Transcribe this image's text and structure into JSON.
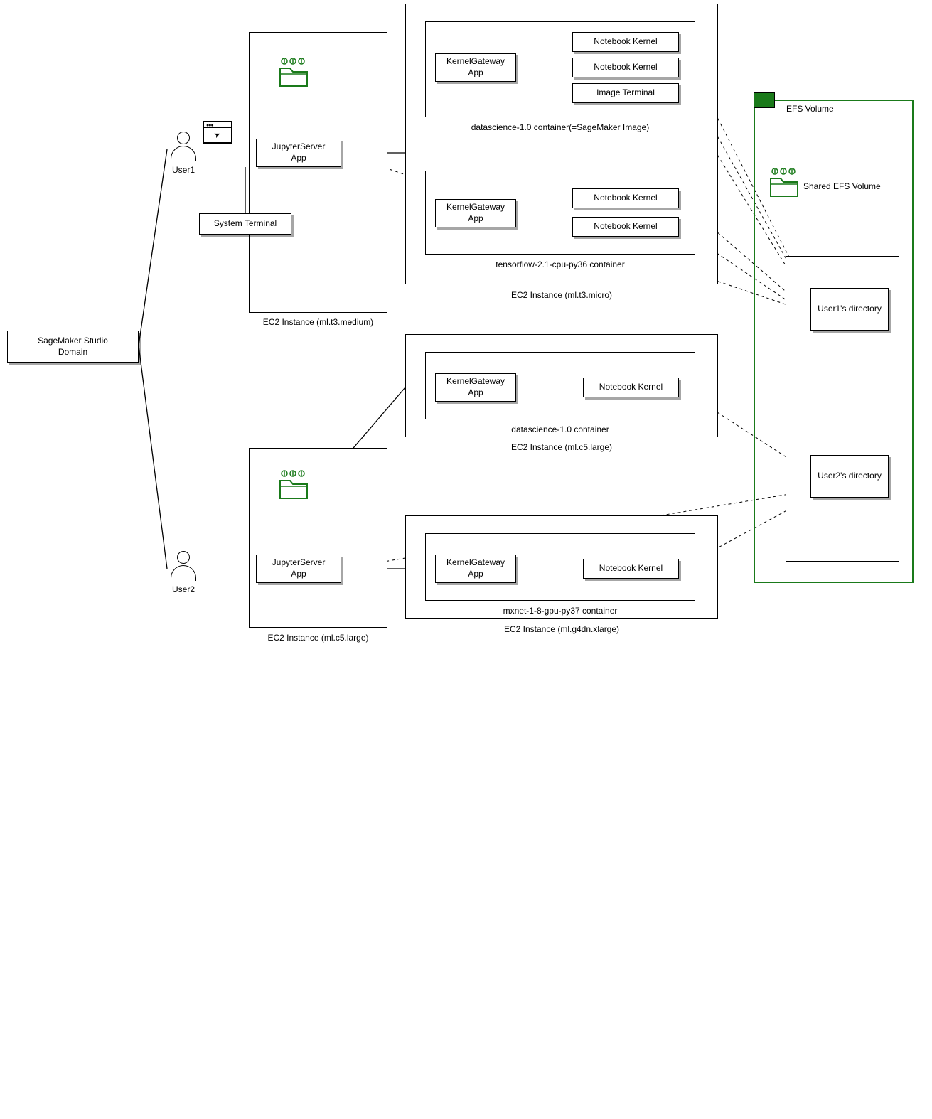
{
  "domain_box": "SageMaker Studio\nDomain",
  "user1_label": "User1",
  "user2_label": "User2",
  "instance1_label": "EC2 Instance (ml.t3.medium)",
  "instance2_label": "EC2 Instance (ml.t3.micro)",
  "instance3_label": "EC2 Instance (ml.c5.large)",
  "instance4_label": "EC2 Instance (ml.c5.large)",
  "instance5_label": "EC2 Instance (ml.g4dn.xlarge)",
  "container1_label": "datascience-1.0 container(=SageMaker Image)",
  "container2_label": "tensorflow-2.1-cpu-py36 container",
  "container3_label": "datascience-1.0 container",
  "container4_label": "mxnet-1-8-gpu-py37 container",
  "jupyter_app": "JupyterServer\nApp",
  "kgw_app": "KernelGateway\nApp",
  "notebook_kernel": "Notebook Kernel",
  "image_terminal": "Image Terminal",
  "system_terminal": "System Terminal",
  "efs_label": "EFS Volume",
  "user1_dir": "User1's directory",
  "user2_dir": "User2's directory",
  "efs_shared_label": "Shared EFS Volume"
}
